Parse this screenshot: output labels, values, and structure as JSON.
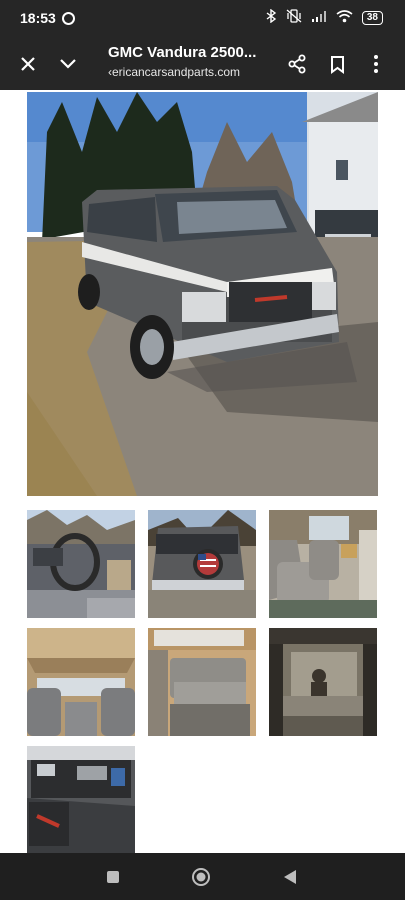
{
  "status_bar": {
    "time": "18:53",
    "battery": "38"
  },
  "toolbar": {
    "title": "GMC Vandura 2500...",
    "url": "‹ericancarsandparts.com"
  },
  "icons": {
    "close": "close-icon",
    "collapse": "chevron-down-icon",
    "share": "share-icon",
    "bookmark": "bookmark-icon",
    "menu": "more-vert-icon"
  },
  "colors": {
    "chrome": "#262626",
    "page": "#ffffff",
    "van_body": "#5a5c5e",
    "grille_logo": "#c0392b"
  },
  "gallery": [
    {
      "name": "van-exterior-main"
    },
    {
      "name": "dashboard-interior"
    },
    {
      "name": "van-rear-spare-tire"
    },
    {
      "name": "rear-seats-captain-chairs"
    },
    {
      "name": "ceiling-interior"
    },
    {
      "name": "bench-seat"
    },
    {
      "name": "rear-cargo-view"
    },
    {
      "name": "engine-bay"
    }
  ]
}
